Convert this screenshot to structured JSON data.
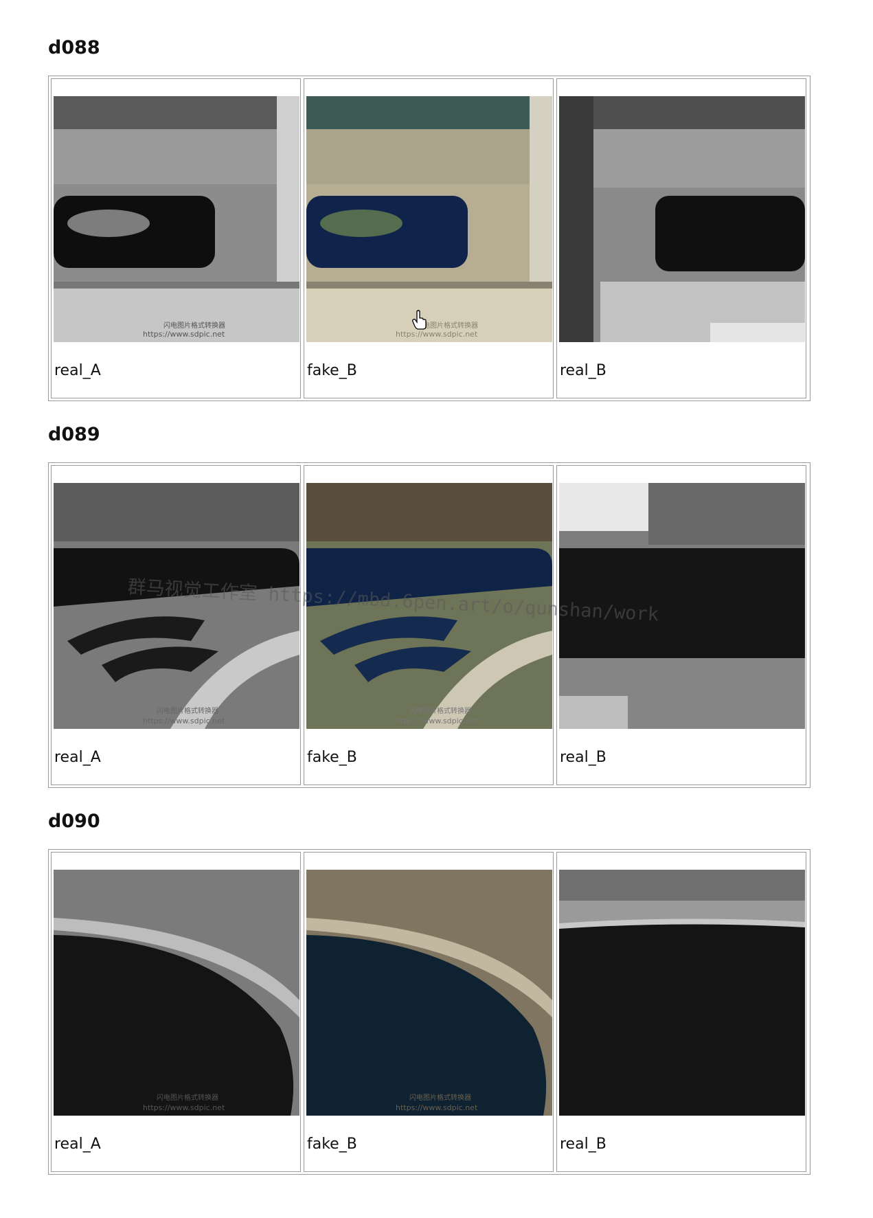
{
  "sections": [
    {
      "title": "d088",
      "images": [
        {
          "label": "real_A"
        },
        {
          "label": "fake_B"
        },
        {
          "label": "real_B"
        }
      ]
    },
    {
      "title": "d089",
      "images": [
        {
          "label": "real_A"
        },
        {
          "label": "fake_B"
        },
        {
          "label": "real_B"
        }
      ]
    },
    {
      "title": "d090",
      "images": [
        {
          "label": "real_A"
        },
        {
          "label": "fake_B"
        },
        {
          "label": "real_B"
        }
      ]
    }
  ],
  "image_text": {
    "source_caption": "闪电图片格式转换器",
    "source_url": "https://www.sdpic.net"
  },
  "watermark": "群马视觉工作室 https://mbd.6pen.art/o/qunshan/work"
}
